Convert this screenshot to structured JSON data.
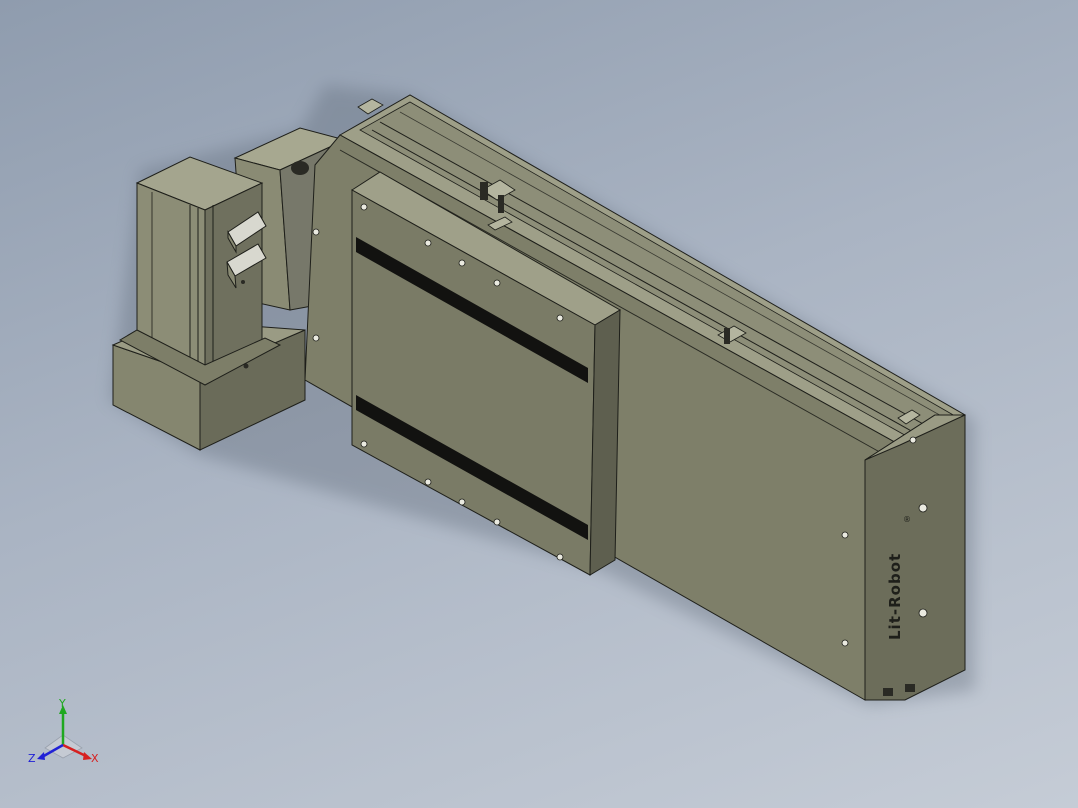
{
  "view": {
    "background_top": "#8f9cae",
    "background_bottom": "#c5ccd6",
    "model_color": "#7b7c68",
    "edge_color": "#1e1f1a"
  },
  "model": {
    "logo_text": "Lit-Robot",
    "logo_mark": "®"
  },
  "triad": {
    "x_label": "X",
    "y_label": "Y",
    "z_label": "Z",
    "x_color": "#d62020",
    "y_color": "#1fa81f",
    "z_color": "#2020d6"
  }
}
